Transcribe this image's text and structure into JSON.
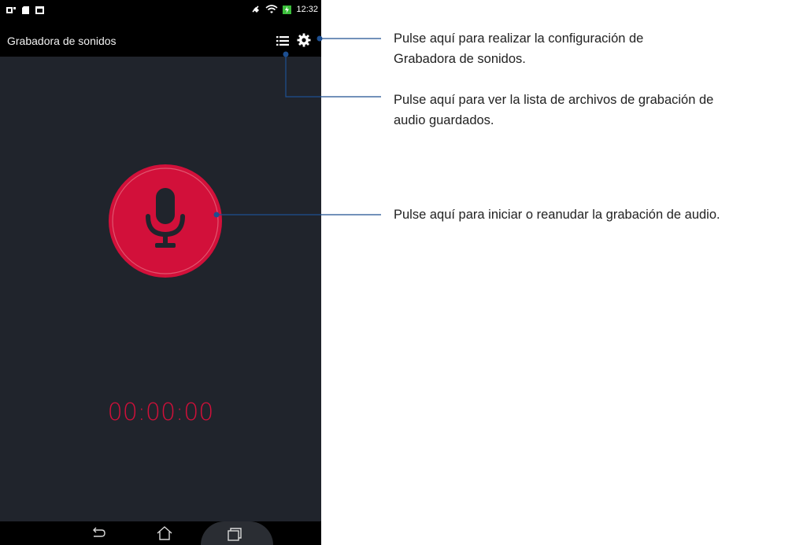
{
  "status_bar": {
    "time": "12:32",
    "left_icons": [
      "notification-icon",
      "sd-card-icon",
      "image-icon"
    ],
    "right_icons": [
      "mute-icon",
      "wifi-icon",
      "battery-charging-icon"
    ]
  },
  "action_bar": {
    "title": "Grabadora de sonidos",
    "list_icon": "list-icon",
    "settings_icon": "gear-icon"
  },
  "main": {
    "record_button_icon": "microphone-icon",
    "timer": "00:00:00"
  },
  "nav_bar": {
    "back": "back-icon",
    "home": "home-icon",
    "recents": "recent-apps-icon"
  },
  "annotations": {
    "settings_line1": "Pulse aquí para realizar la configuración de",
    "settings_line2": "Grabadora de sonidos.",
    "list_line1": "Pulse aquí para ver la lista de archivos de grabación de",
    "list_line2": "audio guardados.",
    "record": "Pulse aquí para iniciar o reanudar la grabación de audio."
  },
  "colors": {
    "accent_red": "#d2103a",
    "callout_line": "#1d4f91",
    "background": "#20242c"
  }
}
